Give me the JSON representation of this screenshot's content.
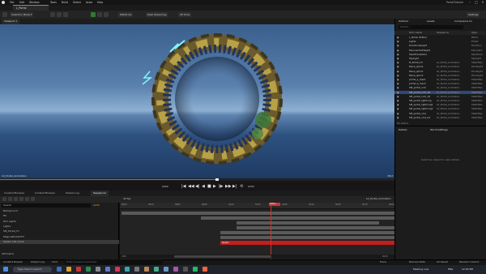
{
  "menubar": {
    "items": [
      "File",
      "Edit",
      "Window",
      "Tools",
      "Build",
      "Select",
      "Actor",
      "Help"
    ],
    "window_title": "PortalTutorial"
  },
  "document_tab": {
    "label": "L_Portal"
  },
  "toolbar": {
    "select_mode": "Selection Mode",
    "platforms": "Platforms",
    "pixel_streaming": "Pixel Streaming",
    "vp_tools": "VP Tools",
    "settings": "Settings"
  },
  "viewport": {
    "tab": "Viewport 1",
    "overlay_left": "L0_Portal_Animation",
    "overlay_right": "Pilot"
  },
  "transport": {
    "left_time": "0000",
    "right_time": "0250",
    "buttons": [
      "|◀",
      "◀◀",
      "◀|",
      "◀",
      "■",
      "▶",
      "|▶",
      "▶▶",
      "▶|",
      "⟲"
    ]
  },
  "outliner": {
    "tabs": [
      "Outliner",
      "Levels",
      "Composure Co"
    ],
    "search_placeholder": "Search...",
    "headers": [
      "Item Label",
      "Sequence",
      "Type"
    ],
    "rows": [
      {
        "label": "L_Portal (Editor)",
        "seq": "",
        "type": "World",
        "sel": false
      },
      {
        "label": "Lights",
        "seq": "",
        "type": "Folder",
        "sel": false
      },
      {
        "label": "DirectionalLight",
        "seq": "",
        "type": "Direction",
        "sel": false
      },
      {
        "label": "ExponentialHeight",
        "seq": "",
        "type": "Exponent",
        "sel": false
      },
      {
        "label": "SkyAtmosphere",
        "seq": "",
        "type": "SkyAtmos",
        "sel": false
      },
      {
        "label": "SkyLight",
        "seq": "",
        "type": "SkyLight",
        "sel": false
      },
      {
        "label": "M_Portal_FX",
        "seq": "L0_Portal_Animation",
        "type": "StaticMes",
        "sel": false
      },
      {
        "label": "Plane_spline",
        "seq": "L0_Portal_Animation",
        "type": "PointLight",
        "sel": false
      },
      {
        "label": "Plane_splin2",
        "seq": "L0_Portal_Animation",
        "type": "PointLight",
        "sel": false
      },
      {
        "label": "Plane_splin3",
        "seq": "L0_Portal_Animation",
        "type": "PointLight",
        "sel": false
      },
      {
        "label": "portal_a_mesh",
        "seq": "L0_Portal_Animation",
        "type": "StaticMes",
        "sel": false
      },
      {
        "label": "portal_b_mesh",
        "seq": "L0_Portal_Animation",
        "type": "StaticMes",
        "sel": false
      },
      {
        "label": "SM_portal_rock",
        "seq": "L0_Portal_Animation",
        "type": "StaticMes",
        "sel": false
      },
      {
        "label": "SM_portal_rock_02",
        "seq": "L0_Portal_Animation",
        "type": "StaticMes",
        "sel": true
      },
      {
        "label": "SM_portal_rock_03",
        "seq": "L0_Portal_Animation",
        "type": "StaticMes",
        "sel": false
      },
      {
        "label": "SM_portal_lightning",
        "seq": "L0_Portal_Animation",
        "type": "StaticMes",
        "sel": false
      },
      {
        "label": "SM_portal_lightning2",
        "seq": "L0_Portal_Animation",
        "type": "StaticMes",
        "sel": false
      },
      {
        "label": "SM_portal_lightning3",
        "seq": "L0_Portal_Animation",
        "type": "StaticMes",
        "sel": false
      },
      {
        "label": "SM_portal_vine",
        "seq": "L0_Portal_Animation",
        "type": "StaticMes",
        "sel": false
      },
      {
        "label": "SM_portal_vine_02",
        "seq": "L0_Portal_Animation",
        "type": "StaticMes",
        "sel": false
      }
    ],
    "footer": "52 actors"
  },
  "details": {
    "tabs": [
      "Details",
      "World Settings"
    ],
    "empty_text": "Select an object to view details."
  },
  "bottom_tabs": [
    "Content Browser",
    "Content Browser",
    "Output Log",
    "Sequencer"
  ],
  "sequencer": {
    "fps": "30 fps",
    "name": "L0_Portal_Animation",
    "search_value": "Search",
    "current_frame": "0250",
    "ruler_labels": [
      "0000",
      "0030",
      "0060",
      "0090",
      "0120",
      "0150",
      "0180",
      "0210",
      "0240",
      "0270",
      "0300"
    ],
    "playhead_label": "0250+",
    "tracks": [
      {
        "label": "Background",
        "sel": false
      },
      {
        "label": "Fill",
        "sel": false
      },
      {
        "label": "Rim Lights",
        "sel": false
      },
      {
        "label": "Lights",
        "sel": false
      },
      {
        "label": "SM_Portal_Fx",
        "sel": false
      },
      {
        "label": "MagicalPortalVFX",
        "sel": false
      },
      {
        "label": "Spawn Life Cycle",
        "sel": true
      }
    ],
    "bar_label": "Spawn",
    "bottom_left": "-015",
    "bottom_right": "0015",
    "items_count": "283 items"
  },
  "statusbar": {
    "items": [
      "Content Drawer",
      "Output Log",
      "Cmd"
    ],
    "console_placeholder": "Enter Console Command",
    "right_items": [
      "Trace",
      "Derived Data",
      "All Saved",
      "Revision Control"
    ]
  },
  "taskbar": {
    "search_placeholder": "Type here to search",
    "tray_text": "Meeting now",
    "lang": "ENG",
    "time": "12:00 PM"
  }
}
